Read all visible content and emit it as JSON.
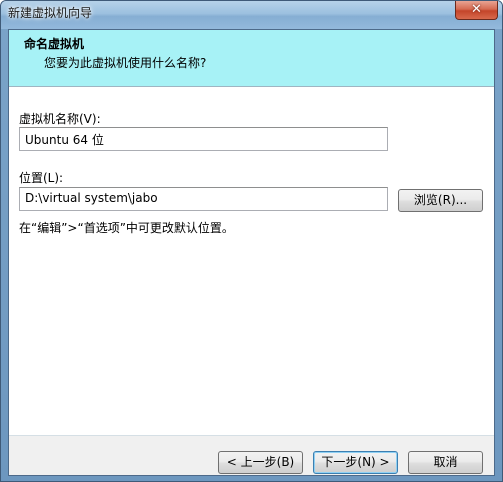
{
  "window": {
    "title": "新建虚拟机向导"
  },
  "header": {
    "title": "命名虚拟机",
    "subtitle": "您要为此虚拟机使用什么名称?"
  },
  "form": {
    "name_label": "虚拟机名称(V):",
    "name_value": "Ubuntu 64 位",
    "location_label": "位置(L):",
    "location_value": "D:\\virtual system\\jabo",
    "browse_label": "浏览(R)...",
    "hint": "在“编辑”>“首选项”中可更改默认位置。"
  },
  "footer": {
    "back_label": "< 上一步(B)",
    "next_label": "下一步(N) >",
    "cancel_label": "取消"
  },
  "icons": {
    "close": "close-icon"
  }
}
